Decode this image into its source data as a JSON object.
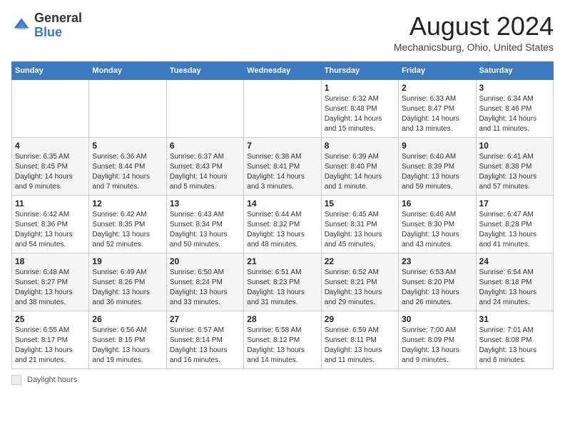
{
  "header": {
    "logo_general": "General",
    "logo_blue": "Blue",
    "month_title": "August 2024",
    "location": "Mechanicsburg, Ohio, United States"
  },
  "weekdays": [
    "Sunday",
    "Monday",
    "Tuesday",
    "Wednesday",
    "Thursday",
    "Friday",
    "Saturday"
  ],
  "weeks": [
    [
      {
        "day": "",
        "info": ""
      },
      {
        "day": "",
        "info": ""
      },
      {
        "day": "",
        "info": ""
      },
      {
        "day": "",
        "info": ""
      },
      {
        "day": "1",
        "info": "Sunrise: 6:32 AM\nSunset: 8:48 PM\nDaylight: 14 hours and 15 minutes."
      },
      {
        "day": "2",
        "info": "Sunrise: 6:33 AM\nSunset: 8:47 PM\nDaylight: 14 hours and 13 minutes."
      },
      {
        "day": "3",
        "info": "Sunrise: 6:34 AM\nSunset: 8:46 PM\nDaylight: 14 hours and 11 minutes."
      }
    ],
    [
      {
        "day": "4",
        "info": "Sunrise: 6:35 AM\nSunset: 8:45 PM\nDaylight: 14 hours and 9 minutes."
      },
      {
        "day": "5",
        "info": "Sunrise: 6:36 AM\nSunset: 8:44 PM\nDaylight: 14 hours and 7 minutes."
      },
      {
        "day": "6",
        "info": "Sunrise: 6:37 AM\nSunset: 8:43 PM\nDaylight: 14 hours and 5 minutes."
      },
      {
        "day": "7",
        "info": "Sunrise: 6:38 AM\nSunset: 8:41 PM\nDaylight: 14 hours and 3 minutes."
      },
      {
        "day": "8",
        "info": "Sunrise: 6:39 AM\nSunset: 8:40 PM\nDaylight: 14 hours and 1 minute."
      },
      {
        "day": "9",
        "info": "Sunrise: 6:40 AM\nSunset: 8:39 PM\nDaylight: 13 hours and 59 minutes."
      },
      {
        "day": "10",
        "info": "Sunrise: 6:41 AM\nSunset: 8:38 PM\nDaylight: 13 hours and 57 minutes."
      }
    ],
    [
      {
        "day": "11",
        "info": "Sunrise: 6:42 AM\nSunset: 8:36 PM\nDaylight: 13 hours and 54 minutes."
      },
      {
        "day": "12",
        "info": "Sunrise: 6:42 AM\nSunset: 8:35 PM\nDaylight: 13 hours and 52 minutes."
      },
      {
        "day": "13",
        "info": "Sunrise: 6:43 AM\nSunset: 8:34 PM\nDaylight: 13 hours and 50 minutes."
      },
      {
        "day": "14",
        "info": "Sunrise: 6:44 AM\nSunset: 8:32 PM\nDaylight: 13 hours and 48 minutes."
      },
      {
        "day": "15",
        "info": "Sunrise: 6:45 AM\nSunset: 8:31 PM\nDaylight: 13 hours and 45 minutes."
      },
      {
        "day": "16",
        "info": "Sunrise: 6:46 AM\nSunset: 8:30 PM\nDaylight: 13 hours and 43 minutes."
      },
      {
        "day": "17",
        "info": "Sunrise: 6:47 AM\nSunset: 8:28 PM\nDaylight: 13 hours and 41 minutes."
      }
    ],
    [
      {
        "day": "18",
        "info": "Sunrise: 6:48 AM\nSunset: 8:27 PM\nDaylight: 13 hours and 38 minutes."
      },
      {
        "day": "19",
        "info": "Sunrise: 6:49 AM\nSunset: 8:26 PM\nDaylight: 13 hours and 36 minutes."
      },
      {
        "day": "20",
        "info": "Sunrise: 6:50 AM\nSunset: 8:24 PM\nDaylight: 13 hours and 33 minutes."
      },
      {
        "day": "21",
        "info": "Sunrise: 6:51 AM\nSunset: 8:23 PM\nDaylight: 13 hours and 31 minutes."
      },
      {
        "day": "22",
        "info": "Sunrise: 6:52 AM\nSunset: 8:21 PM\nDaylight: 13 hours and 29 minutes."
      },
      {
        "day": "23",
        "info": "Sunrise: 6:53 AM\nSunset: 8:20 PM\nDaylight: 13 hours and 26 minutes."
      },
      {
        "day": "24",
        "info": "Sunrise: 6:54 AM\nSunset: 8:18 PM\nDaylight: 13 hours and 24 minutes."
      }
    ],
    [
      {
        "day": "25",
        "info": "Sunrise: 6:55 AM\nSunset: 8:17 PM\nDaylight: 13 hours and 21 minutes."
      },
      {
        "day": "26",
        "info": "Sunrise: 6:56 AM\nSunset: 8:15 PM\nDaylight: 13 hours and 19 minutes."
      },
      {
        "day": "27",
        "info": "Sunrise: 6:57 AM\nSunset: 8:14 PM\nDaylight: 13 hours and 16 minutes."
      },
      {
        "day": "28",
        "info": "Sunrise: 6:58 AM\nSunset: 8:12 PM\nDaylight: 13 hours and 14 minutes."
      },
      {
        "day": "29",
        "info": "Sunrise: 6:59 AM\nSunset: 8:11 PM\nDaylight: 13 hours and 11 minutes."
      },
      {
        "day": "30",
        "info": "Sunrise: 7:00 AM\nSunset: 8:09 PM\nDaylight: 13 hours and 9 minutes."
      },
      {
        "day": "31",
        "info": "Sunrise: 7:01 AM\nSunset: 8:08 PM\nDaylight: 13 hours and 6 minutes."
      }
    ]
  ],
  "legend": {
    "label": "Daylight hours"
  }
}
